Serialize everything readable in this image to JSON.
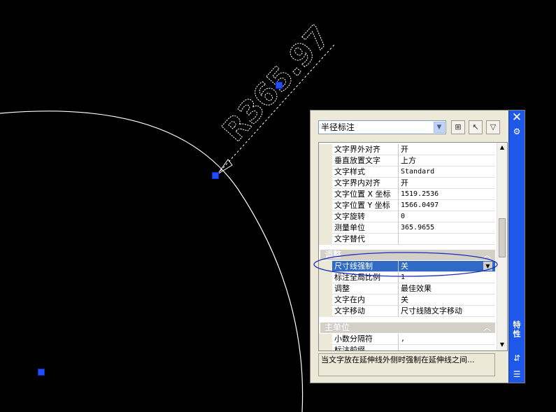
{
  "drawing": {
    "dimension_text": "R365.97"
  },
  "palette": {
    "object_type": "半径标注",
    "title": "特性",
    "toolbar": [
      "quick-select-icon",
      "select-objects-icon",
      "toggle-pickadd-icon"
    ],
    "rows_text": [
      {
        "label": "文字界外对齐",
        "value": "开"
      },
      {
        "label": "垂直放置文字",
        "value": "上方"
      },
      {
        "label": "文字样式",
        "value": "Standard"
      },
      {
        "label": "文字界内对齐",
        "value": "开"
      },
      {
        "label": "文字位置 X 坐标",
        "value": "1519.2536"
      },
      {
        "label": "文字位置 Y 坐标",
        "value": "1566.0497"
      },
      {
        "label": "文字旋转",
        "value": "0"
      },
      {
        "label": "测量单位",
        "value": "365.9655"
      },
      {
        "label": "文字替代",
        "value": ""
      }
    ],
    "section_fit": "调整",
    "rows_fit": [
      {
        "label": "尺寸线强制",
        "value": "关"
      },
      {
        "label": "标注全局比例",
        "value": "1"
      },
      {
        "label": "调整",
        "value": "最佳效果"
      },
      {
        "label": "文字在内",
        "value": "关"
      },
      {
        "label": "文字移动",
        "value": "尺寸线随文字移动"
      }
    ],
    "section_primary": "主单位",
    "rows_primary": [
      {
        "label": "小数分隔符",
        "value": ","
      },
      {
        "label": "标注前缀",
        "value": ""
      }
    ],
    "description": "当文字放在延伸线外侧时强制在延伸线之间..."
  },
  "colors": {
    "background": "#000000",
    "selection": "#316ac5",
    "title_bar": "#1e58e8",
    "grip": "#1f4fff",
    "annotation_ellipse": "#1a2fb8"
  }
}
